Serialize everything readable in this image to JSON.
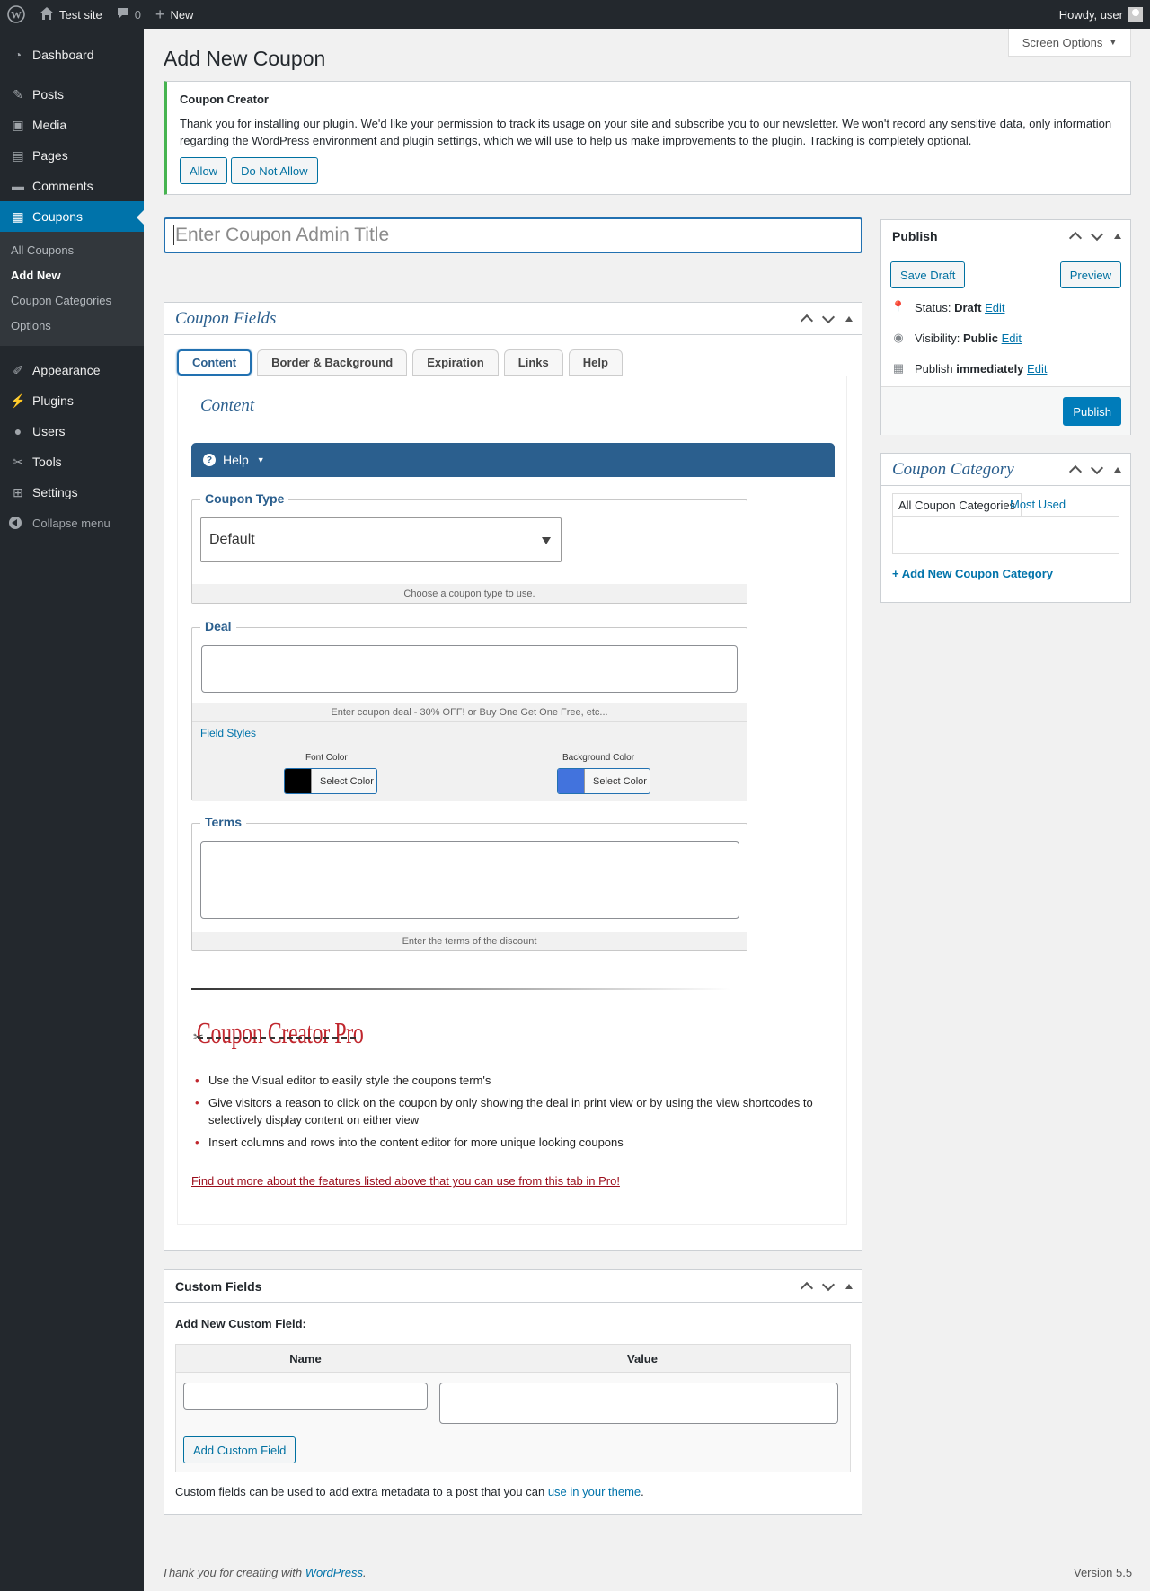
{
  "adminbar": {
    "site_name": "Test site",
    "comments_count": "0",
    "new_label": "New",
    "howdy": "Howdy, user"
  },
  "sidebar": {
    "items": [
      {
        "label": "Dashboard",
        "icon": "dashboard-icon"
      },
      {
        "label": "Posts",
        "icon": "pin-icon"
      },
      {
        "label": "Media",
        "icon": "media-icon"
      },
      {
        "label": "Pages",
        "icon": "pages-icon"
      },
      {
        "label": "Comments",
        "icon": "comment-icon"
      },
      {
        "label": "Coupons",
        "icon": "coupon-icon"
      },
      {
        "label": "Appearance",
        "icon": "brush-icon"
      },
      {
        "label": "Plugins",
        "icon": "plugin-icon"
      },
      {
        "label": "Users",
        "icon": "user-icon"
      },
      {
        "label": "Tools",
        "icon": "wrench-icon"
      },
      {
        "label": "Settings",
        "icon": "settings-icon"
      }
    ],
    "submenu": [
      "All Coupons",
      "Add New",
      "Coupon Categories",
      "Options"
    ],
    "collapse_label": "Collapse menu"
  },
  "screen_options": "Screen Options",
  "page_title": "Add New Coupon",
  "notice": {
    "title": "Coupon Creator",
    "body": "Thank you for installing our plugin. We'd like your permission to track its usage on your site and subscribe you to our newsletter. We won't record any sensitive data, only information regarding the WordPress environment and plugin settings, which we will use to help us make improvements to the plugin. Tracking is completely optional.",
    "allow": "Allow",
    "deny": "Do Not Allow"
  },
  "title_placeholder": "Enter Coupon Admin Title",
  "coupon_fields": {
    "title": "Coupon Fields",
    "tabs": [
      "Content",
      "Border & Background",
      "Expiration",
      "Links",
      "Help"
    ],
    "section_title": "Content",
    "help_label": "Help",
    "coupon_type": {
      "legend": "Coupon Type",
      "value": "Default",
      "help": "Choose a coupon type to use."
    },
    "deal": {
      "legend": "Deal",
      "help": "Enter coupon deal - 30% OFF! or Buy One Get One Free, etc...",
      "field_styles": "Field Styles",
      "font_color_label": "Font Color",
      "bg_color_label": "Background Color",
      "select_color": "Select Color",
      "font_color": "#000000",
      "bg_color": "#4273dd"
    },
    "terms": {
      "legend": "Terms",
      "help": "Enter the terms of the discount"
    },
    "pro": {
      "logo": "Coupon Creator Pro",
      "features": [
        "Use the Visual editor to easily style the coupons term's",
        "Give visitors a reason to click on the coupon by only showing the deal in print view or by using the view shortcodes to selectively display content on either view",
        "Insert columns and rows into the content editor for more unique looking coupons"
      ],
      "link": "Find out more about the features listed above that you can use from this tab in Pro!"
    }
  },
  "publish": {
    "title": "Publish",
    "save_draft": "Save Draft",
    "preview": "Preview",
    "status_label": "Status:",
    "status_value": "Draft",
    "visibility_label": "Visibility:",
    "visibility_value": "Public",
    "publish_label": "Publish",
    "publish_value": "immediately",
    "edit": "Edit",
    "publish_button": "Publish"
  },
  "coupon_category": {
    "title": "Coupon Category",
    "tab_all": "All Coupon Categories",
    "tab_most_used": "Most Used",
    "add_new": "+ Add New Coupon Category"
  },
  "custom_fields": {
    "title": "Custom Fields",
    "add_new_label": "Add New Custom Field:",
    "col_name": "Name",
    "col_value": "Value",
    "add_button": "Add Custom Field",
    "note_prefix": "Custom fields can be used to add extra metadata to a post that you can",
    "note_link": "use in your theme",
    "note_suffix": "."
  },
  "footer": {
    "thanks_prefix": "Thank you for creating with",
    "thanks_link": "WordPress",
    "thanks_suffix": ".",
    "version": "Version 5.5"
  }
}
